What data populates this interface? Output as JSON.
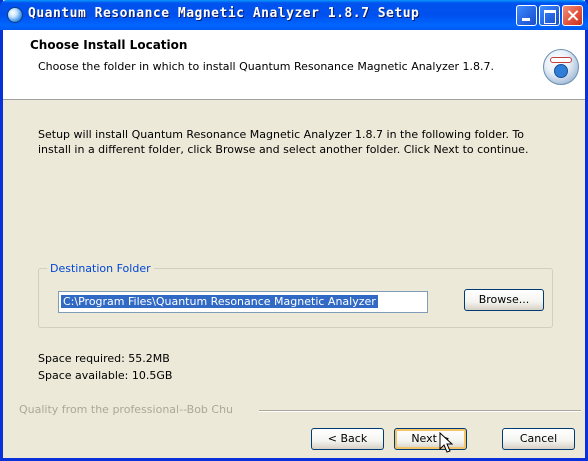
{
  "window": {
    "title": "Quantum Resonance Magnetic Analyzer 1.8.7 Setup"
  },
  "header": {
    "title": "Choose Install Location",
    "subtitle": "Choose the folder in which to install Quantum Resonance Magnetic Analyzer 1.8.7."
  },
  "main": {
    "intro": "Setup will install Quantum Resonance Magnetic Analyzer 1.8.7 in the following folder. To install in a different folder, click Browse and select another folder. Click Next to continue.",
    "destination_label": "Destination Folder",
    "path_value": "C:\\Program Files\\Quantum Resonance Magnetic Analyzer",
    "browse_label": "Browse...",
    "space_required": "Space required: 55.2MB",
    "space_available": "Space available: 10.5GB"
  },
  "footer": {
    "branding": "Quality from the professional--Bob Chu",
    "back_label": "< Back",
    "next_label": "Next >",
    "cancel_label": "Cancel"
  },
  "icons": {
    "title": "installer-app-icon",
    "header": "install-disc-icon",
    "cursor": "mouse-pointer-icon"
  },
  "colors": {
    "titlebar": "#0053ee",
    "selection": "#316ac5",
    "group_label": "#0046d5",
    "dialog_bg": "#ece9d8"
  }
}
